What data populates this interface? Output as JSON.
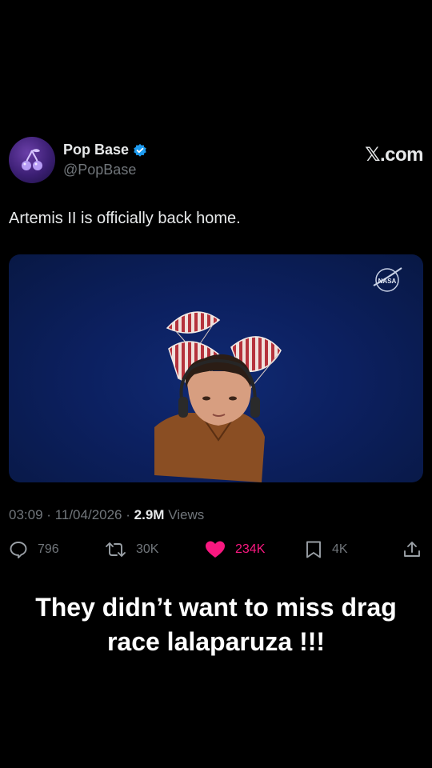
{
  "author": {
    "name": "Pop Base",
    "handle": "@PopBase",
    "verified": true
  },
  "brand": "𝕏.com",
  "tweet": {
    "text": "Artemis II is officially back home."
  },
  "media": {
    "watermark": "NASA"
  },
  "meta": {
    "time": "03:09",
    "date": "11/04/2026",
    "separator": "·",
    "views_count": "2.9M",
    "views_label": "Views"
  },
  "actions": {
    "replies": "796",
    "reposts": "30K",
    "likes": "234K",
    "bookmarks": "4K"
  },
  "caption": "They didn’t want to miss drag race lalaparuza !!!",
  "colors": {
    "background": "#000000",
    "text_primary": "#e7e9ea",
    "text_secondary": "#71767b",
    "verified_blue": "#1d9bf0",
    "like_pink": "#f91880"
  }
}
